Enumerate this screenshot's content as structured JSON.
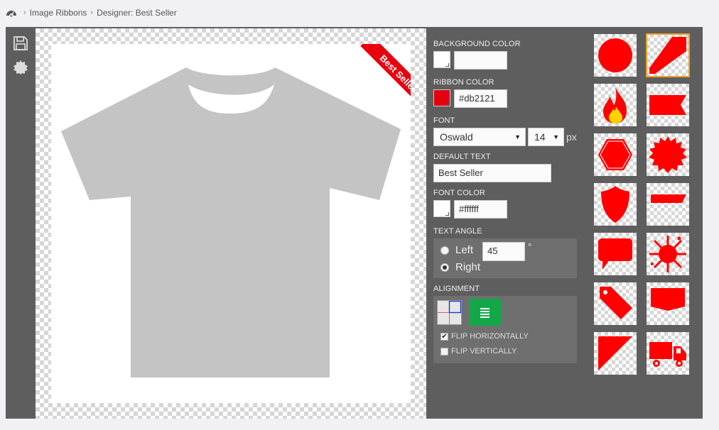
{
  "breadcrumb": {
    "items": [
      "Image Ribbons",
      "Designer: Best Seller"
    ]
  },
  "toolbar": {
    "tools": [
      "save-icon",
      "settings-gear-icon"
    ]
  },
  "ribbon_preview": {
    "text": "Best Seller",
    "ribbon_color": "#db2121",
    "text_color": "#ffffff"
  },
  "properties": {
    "background_color": {
      "label": "BACKGROUND COLOR",
      "value": ""
    },
    "ribbon_color": {
      "label": "RIBBON COLOR",
      "value": "#db2121"
    },
    "font": {
      "label": "FONT",
      "family": "Oswald",
      "size": "14",
      "unit": "px"
    },
    "default_text": {
      "label": "DEFAULT TEXT",
      "value": "Best Seller"
    },
    "font_color": {
      "label": "FONT COLOR",
      "value": "#ffffff"
    },
    "text_angle": {
      "label": "TEXT ANGLE",
      "options": [
        "Left",
        "Right"
      ],
      "selected": "Right",
      "value": "45",
      "unit": "°"
    },
    "alignment": {
      "label": "ALIGNMENT",
      "flip_horizontally": {
        "label": "FLIP HORIZONTALLY",
        "checked": true
      },
      "flip_vertically": {
        "label": "FLIP VERTICALLY",
        "checked": false
      }
    }
  },
  "gallery": {
    "selected": "corner-ribbon",
    "shapes": [
      "circle",
      "corner-ribbon",
      "flame",
      "flag-banner",
      "hexagon",
      "starburst-seal",
      "shield",
      "slanted-banner",
      "speech-bubble",
      "splash",
      "price-tag",
      "pocket-badge",
      "triangle-corner",
      "delivery-truck"
    ]
  },
  "colors": {
    "accent_red": "#ff0000",
    "selected_outline": "#f0a020",
    "align_button_green": "#12a84a"
  }
}
